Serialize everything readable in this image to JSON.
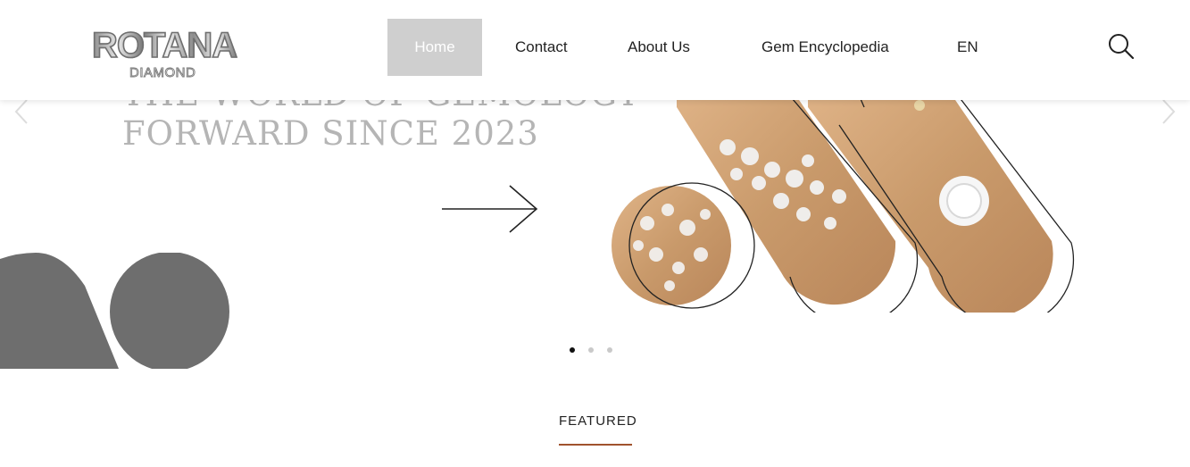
{
  "brand": {
    "logo_main": "ROTANA",
    "logo_sub": "DIAMOND"
  },
  "nav": {
    "items": [
      {
        "label": "Home",
        "active": true
      },
      {
        "label": "Contact"
      },
      {
        "label": "About Us"
      },
      {
        "label": "Gem Encyclopedia"
      },
      {
        "label": "EN"
      }
    ],
    "search_icon": "search-icon"
  },
  "hero": {
    "title_line1": "THE WORLD OF GEMOLOGY",
    "title_line2": "FORWARD SINCE 2023",
    "slides_total": 3,
    "active_slide": 1
  },
  "featured": {
    "label": "FEATURED"
  },
  "colors": {
    "nav_active_bg": "#cfcfcf",
    "accent_underline": "#a0522d",
    "hero_title": "#b5b5b5",
    "deco_shapes": "#6e6e6e",
    "gold_photo": "#c99a6b"
  }
}
